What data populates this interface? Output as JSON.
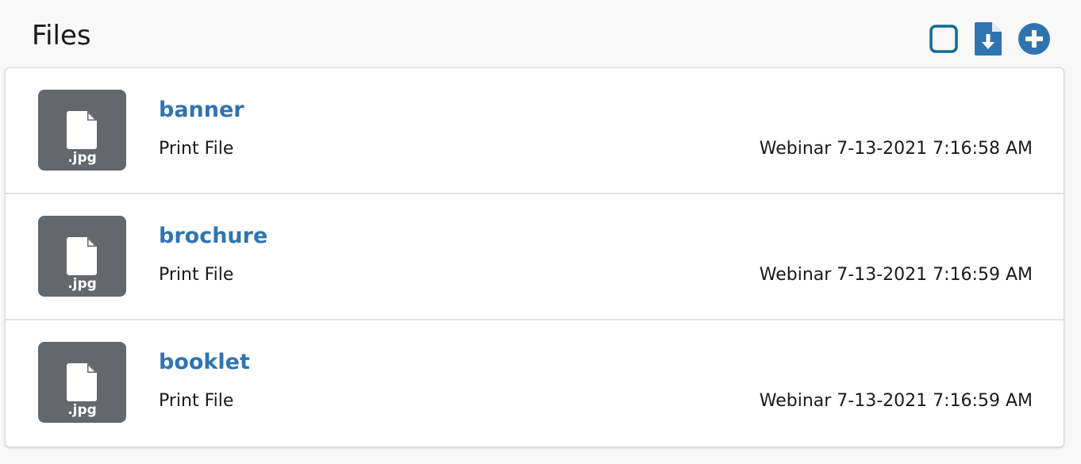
{
  "header": {
    "title": "Files",
    "actions": [
      {
        "icon": "checkbox-icon",
        "color": "#0e6a96"
      },
      {
        "icon": "file-download-icon",
        "color": "#2f74b0"
      },
      {
        "icon": "plus-circle-icon",
        "color": "#2f74b0"
      }
    ]
  },
  "files": [
    {
      "name": "banner",
      "type": "Print File",
      "extension": ".jpg",
      "meta": "Webinar 7-13-2021 7:16:58 AM"
    },
    {
      "name": "brochure",
      "type": "Print File",
      "extension": ".jpg",
      "meta": "Webinar 7-13-2021 7:16:59 AM"
    },
    {
      "name": "booklet",
      "type": "Print File",
      "extension": ".jpg",
      "meta": "Webinar 7-13-2021 7:16:59 AM"
    }
  ],
  "colors": {
    "link": "#2f74b0",
    "thumb_bg": "#64676b",
    "checkbox": "#0e6a96"
  }
}
